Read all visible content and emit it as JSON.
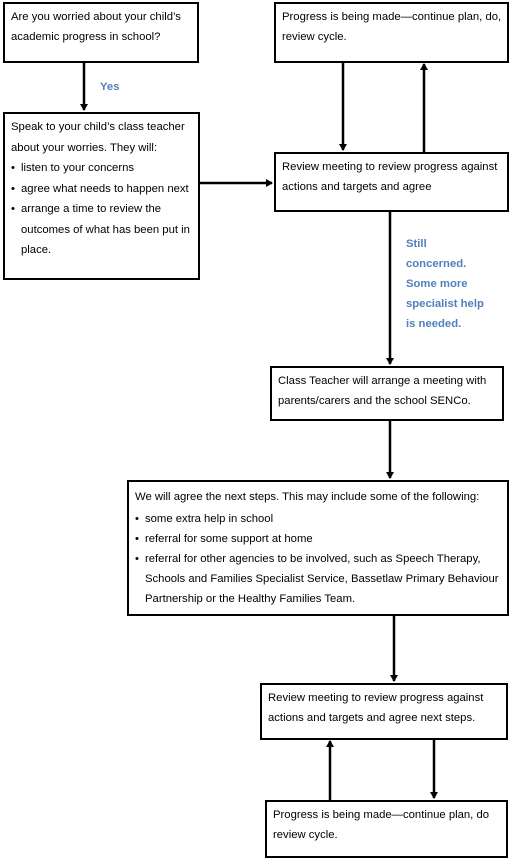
{
  "boxes": {
    "worried": {
      "text": "Are you worried about your child’s academic progress in school?"
    },
    "progress_top": {
      "text": "Progress is being made—continue plan, do, review cycle."
    },
    "speak": {
      "intro": "Speak to your child’s class teacher about your worries.   They will:",
      "items": [
        "listen to your concerns",
        "agree what needs to happen next",
        "arrange a time to review the outcomes of what has been put in place."
      ]
    },
    "review_top": {
      "text": "Review meeting to review progress against actions and targets and agree"
    },
    "class_teacher": {
      "text": "Class Teacher will arrange a meeting with parents/carers and the school SENCo."
    },
    "next_steps": {
      "intro": "We will agree the next steps.  This may include some of the following:",
      "items": [
        "some extra help in school",
        "referral for some support at home",
        "referral for other agencies to be involved, such as Speech Therapy, Schools and Families Specialist Service, Bassetlaw  Primary Behaviour Partnership or the Healthy Families Team."
      ]
    },
    "review_bottom": {
      "text": "Review meeting to review progress against actions and targets and agree next steps."
    },
    "progress_bottom": {
      "text": "Progress is being made—continue plan, do review cycle."
    }
  },
  "labels": {
    "yes": "Yes",
    "still_concerned": [
      "Still",
      "concerned.",
      "Some more",
      "specialist help",
      "is needed."
    ]
  },
  "colors": {
    "label": "#4f81bd",
    "stroke": "#000000"
  }
}
